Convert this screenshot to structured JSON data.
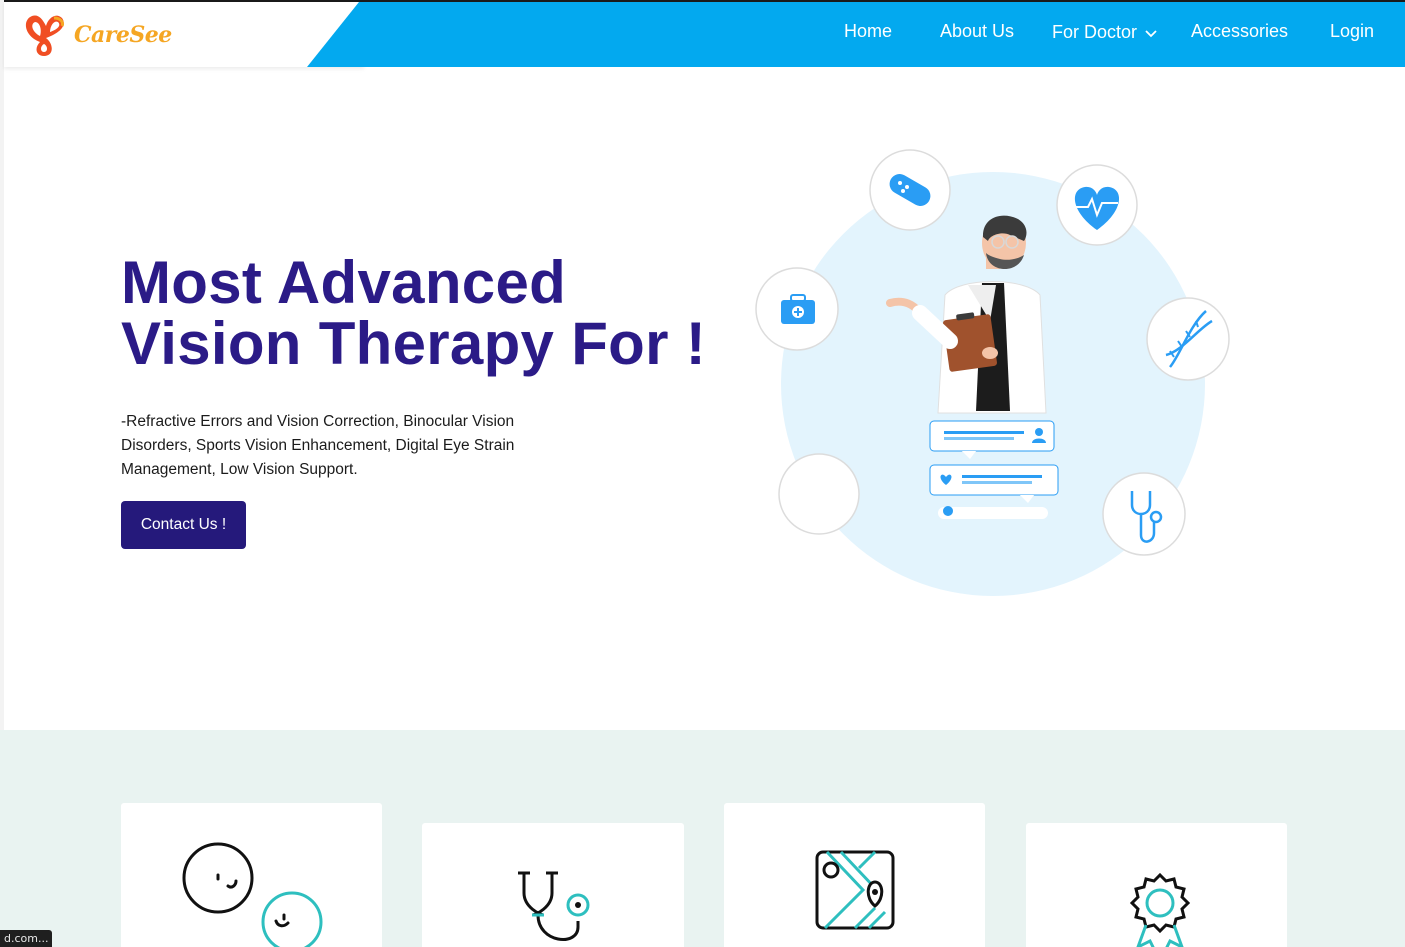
{
  "brand": {
    "name": "CareSee",
    "colors": {
      "primary_blue": "#03a9ef",
      "hero_title": "#2b1b87",
      "button": "#25197b",
      "logo_orange": "#f5a623",
      "logo_red": "#f04e23",
      "accent_teal": "#2ebfbf"
    }
  },
  "nav": {
    "items": [
      {
        "label": "Home"
      },
      {
        "label": "About Us"
      },
      {
        "label": "For Doctor",
        "has_dropdown": true
      },
      {
        "label": "Accessories"
      },
      {
        "label": "Login"
      }
    ]
  },
  "hero": {
    "title_line1": "Most Advanced",
    "title_line2": "Vision Therapy For !",
    "description": "-Refractive Errors and Vision Correction, Binocular Vision Disorders, Sports Vision Enhancement, Digital Eye Strain Management, Low Vision Support.",
    "cta_label": "Contact Us !"
  },
  "illustration": {
    "icons": [
      "bandage-icon",
      "heart-pulse-icon",
      "medical-kit-icon",
      "dna-icon",
      "stethoscope-icon",
      "doctor-figure",
      "chat-bubbles"
    ]
  },
  "features": {
    "cards": [
      {
        "icon": "faces-icon"
      },
      {
        "icon": "stethoscope-icon"
      },
      {
        "icon": "map-pin-icon"
      },
      {
        "icon": "award-badge-icon"
      }
    ]
  },
  "status_bar": {
    "url_fragment": "d.com..."
  }
}
